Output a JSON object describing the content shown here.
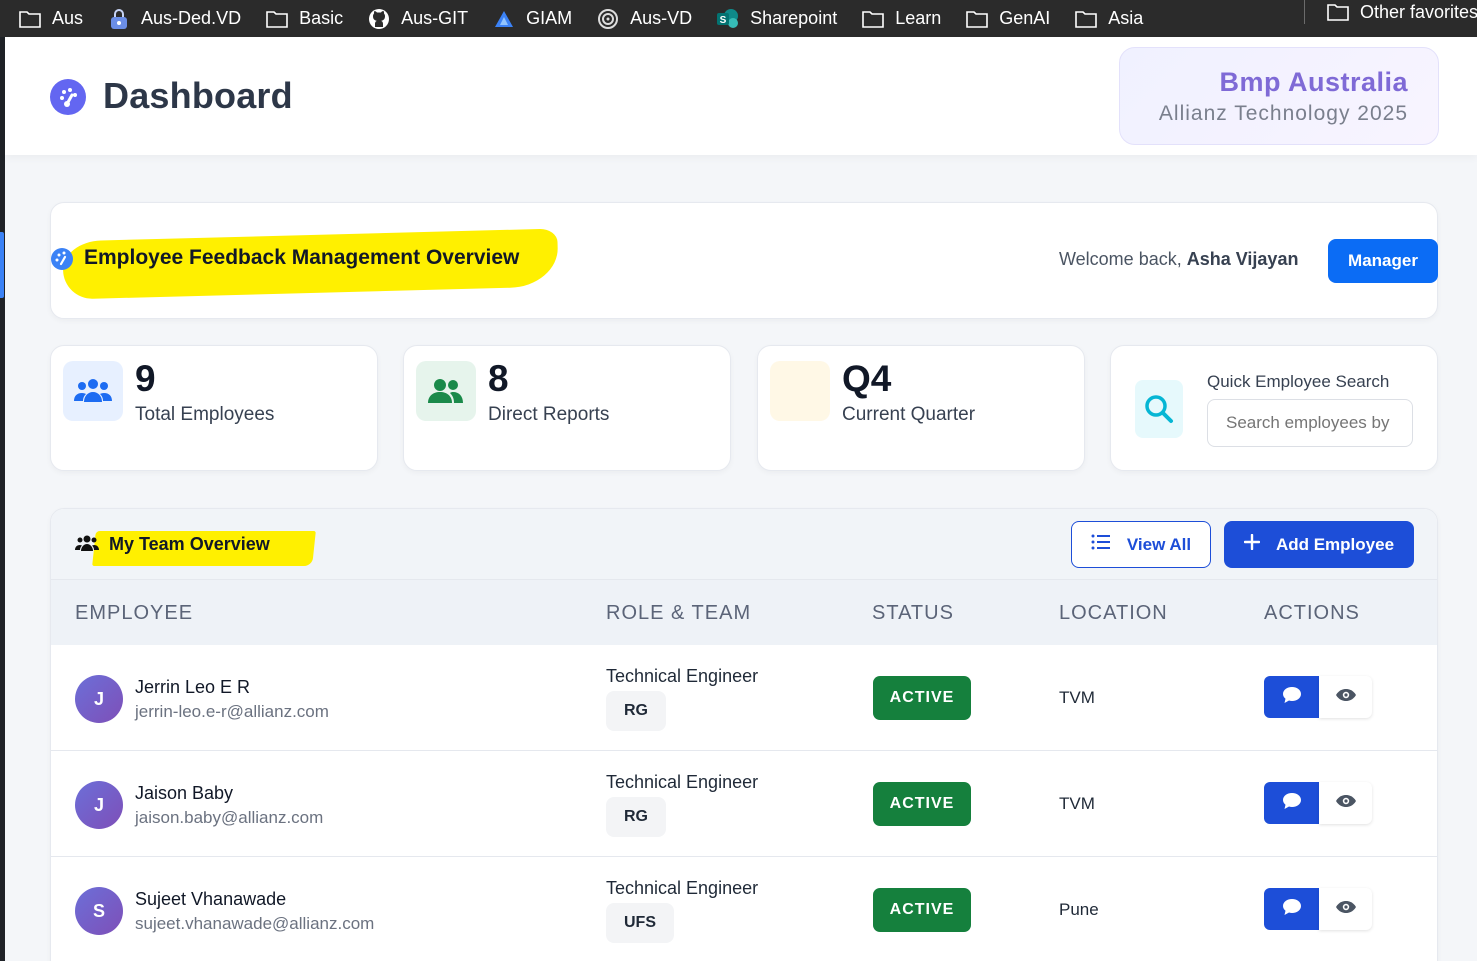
{
  "bookmarks": [
    {
      "label": "Aus",
      "icon": "folder-icon"
    },
    {
      "label": "Aus-Ded.VD",
      "icon": "lock-icon"
    },
    {
      "label": "Basic",
      "icon": "folder-icon"
    },
    {
      "label": "Aus-GIT",
      "icon": "github-icon"
    },
    {
      "label": "GIAM",
      "icon": "giam-icon"
    },
    {
      "label": "Aus-VD",
      "icon": "spiral-icon"
    },
    {
      "label": "Sharepoint",
      "icon": "sharepoint-icon"
    },
    {
      "label": "Learn",
      "icon": "folder-icon"
    },
    {
      "label": "GenAI",
      "icon": "folder-icon"
    },
    {
      "label": "Asia",
      "icon": "folder-icon"
    }
  ],
  "other_favorites": "Other favorites",
  "header": {
    "title": "Dashboard",
    "brand_name": "Bmp Australia",
    "brand_sub": "Allianz Technology 2025"
  },
  "overview": {
    "title": "Employee Feedback Management Overview",
    "welcome_prefix": "Welcome back, ",
    "user_name": "Asha Vijayan",
    "role_button": "Manager"
  },
  "stats": [
    {
      "value": "9",
      "label": "Total Employees",
      "icon": "users-icon",
      "bg": "#e7f0ff",
      "color": "#1d6cf2"
    },
    {
      "value": "8",
      "label": "Direct Reports",
      "icon": "user-group-icon",
      "bg": "#e6f4ec",
      "color": "#1a8a4a"
    },
    {
      "value": "Q4",
      "label": "Current Quarter",
      "icon": "calendar-icon",
      "bg": "#fff8e6",
      "color": "#f5c542"
    }
  ],
  "search": {
    "label": "Quick Employee Search",
    "placeholder": "Search employees by"
  },
  "team": {
    "title": "My Team Overview",
    "view_all": "View All",
    "add_employee": "Add Employee",
    "columns": [
      "EMPLOYEE",
      "ROLE & TEAM",
      "STATUS",
      "LOCATION",
      "ACTIONS"
    ],
    "rows": [
      {
        "initial": "J",
        "name": "Jerrin Leo E R",
        "email": "jerrin-leo.e-r@allianz.com",
        "role": "Technical Engineer",
        "team": "RG",
        "status": "ACTIVE",
        "location": "TVM"
      },
      {
        "initial": "J",
        "name": "Jaison Baby",
        "email": "jaison.baby@allianz.com",
        "role": "Technical Engineer",
        "team": "RG",
        "status": "ACTIVE",
        "location": "TVM"
      },
      {
        "initial": "S",
        "name": "Sujeet Vhanawade",
        "email": "sujeet.vhanawade@allianz.com",
        "role": "Technical Engineer",
        "team": "UFS",
        "status": "ACTIVE",
        "location": "Pune"
      }
    ]
  },
  "colors": {
    "primary": "#1d4ed8",
    "manager_button": "#0b6cf5",
    "status_active": "#15803d",
    "brand_text": "#7f6ad6",
    "highlight": "#fff000"
  }
}
